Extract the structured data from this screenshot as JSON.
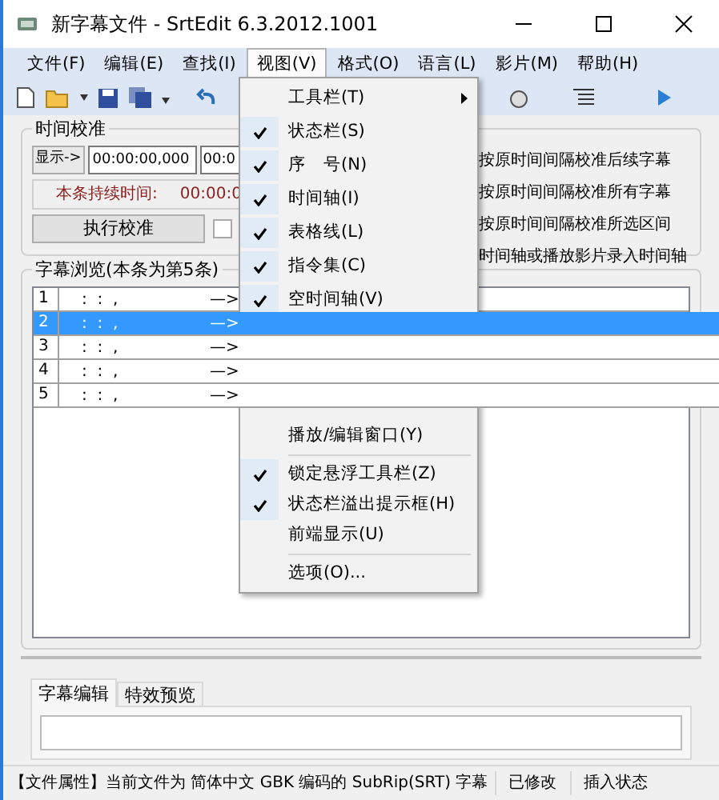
{
  "window": {
    "title": "新字幕文件 - SrtEdit 6.3.2012.1001"
  },
  "menubar": [
    {
      "label": "文件(F)",
      "selected": false
    },
    {
      "label": "编辑(E)",
      "selected": false
    },
    {
      "label": "查找(I)",
      "selected": false
    },
    {
      "label": "视图(V)",
      "selected": true
    },
    {
      "label": "格式(O)",
      "selected": false
    },
    {
      "label": "语言(L)",
      "selected": false
    },
    {
      "label": "影片(M)",
      "selected": false
    },
    {
      "label": "帮助(H)",
      "selected": false
    }
  ],
  "time_calibration": {
    "title": "时间校准",
    "show_button": "显示->",
    "start_field": "00:00:00,000",
    "end_field": "00:0",
    "duration_label": "本条持续时间:",
    "duration_value": "00:00:0",
    "execute_button": "执行校准",
    "checkbox_checked": false,
    "options": [
      "按原时间间隔校准后续字幕",
      "按原时间间隔校准所有字幕",
      "按原时间间隔校准所选区间",
      "时间轴或播放影片录入时间轴"
    ]
  },
  "subtitle_browser": {
    "title": "字幕浏览(本条为第5条)",
    "rows": [
      {
        "index": "1",
        "time": ":  :  ,",
        "arrow": "—>",
        "selected": false
      },
      {
        "index": "2",
        "time": ":  :  ,",
        "arrow": "—>",
        "selected": true
      },
      {
        "index": "3",
        "time": ":  :  ,",
        "arrow": "—>",
        "selected": false
      },
      {
        "index": "4",
        "time": ":  :  ,",
        "arrow": "—>",
        "selected": false
      },
      {
        "index": "5",
        "time": ":  :  ,",
        "arrow": "—>",
        "selected": false
      }
    ]
  },
  "view_menu": {
    "items_above_list": [
      {
        "kind": "item",
        "label": "工具栏(T)",
        "checked": false,
        "submenu": true
      },
      {
        "kind": "item",
        "label": "状态栏(S)",
        "checked": true,
        "submenu": false
      },
      {
        "kind": "item",
        "label": "序　号(N)",
        "checked": true,
        "submenu": false
      },
      {
        "kind": "item",
        "label": "时间轴(I)",
        "checked": true,
        "submenu": false
      },
      {
        "kind": "item",
        "label": "表格线(L)",
        "checked": true,
        "submenu": false
      },
      {
        "kind": "item",
        "label": "指令集(C)",
        "checked": true,
        "submenu": false
      },
      {
        "kind": "item",
        "label": "空时间轴(V)",
        "checked": true,
        "submenu": false
      }
    ],
    "items_below_list": [
      {
        "kind": "item",
        "label": "播放/编辑窗口(Y)",
        "checked": false,
        "submenu": false
      },
      {
        "kind": "separator"
      },
      {
        "kind": "item",
        "label": "锁定悬浮工具栏(Z)",
        "checked": true,
        "submenu": false
      },
      {
        "kind": "item",
        "label": "状态栏溢出提示框(H)",
        "checked": true,
        "submenu": false
      },
      {
        "kind": "item",
        "label": "前端显示(U)",
        "checked": false,
        "submenu": false
      },
      {
        "kind": "separator"
      },
      {
        "kind": "item",
        "label": "选项(O)...",
        "checked": false,
        "submenu": false
      }
    ]
  },
  "editor_tabs": [
    {
      "label": "字幕编辑",
      "selected": true
    },
    {
      "label": "特效预览",
      "selected": false
    }
  ],
  "status_bar": [
    "【文件属性】当前文件为 简体中文 GBK 编码的 SubRip(SRT) 字幕",
    "已修改",
    "插入状态"
  ]
}
